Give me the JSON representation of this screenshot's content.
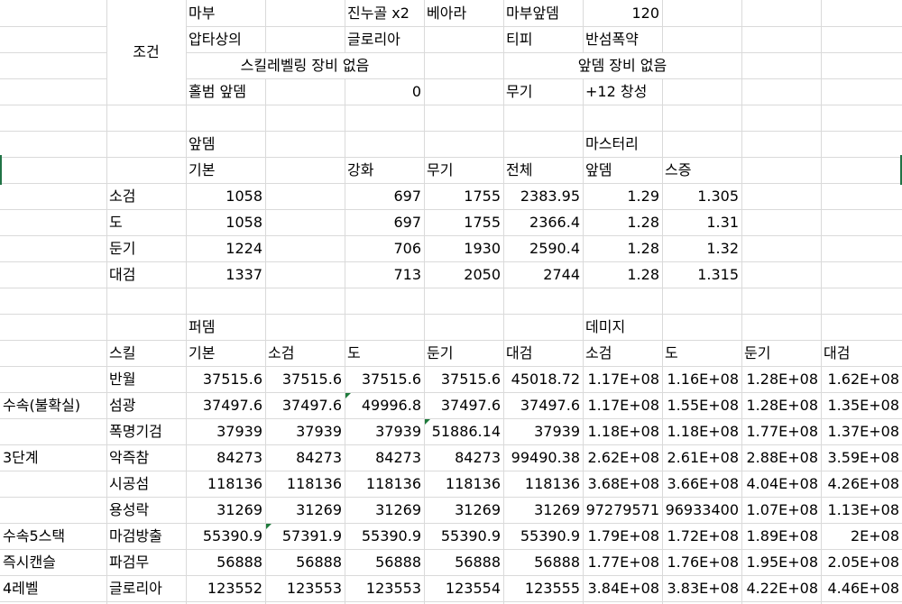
{
  "condition": {
    "title": "조건",
    "mabu": "마부",
    "jinugol": "진누골 x2",
    "beara": "베아라",
    "mabu_apdem": "마부앞뎀",
    "mabu_apdem_value": "120",
    "aptasang": "압타상의",
    "gloria": "글로리아",
    "tipi": "티피",
    "bansum": "반섬폭약",
    "skill_level_note": "스킬레벨링 장비 없음",
    "apdem_equip_note": "앞뎀 장비 없음",
    "holbum": "홀범 앞뎀",
    "holbum_value": "0",
    "weapon": "무기",
    "weapon_value": "+12 창성"
  },
  "apdem": {
    "title": "앞뎀",
    "mastery_title": "마스터리",
    "headers": [
      "기본",
      "강화",
      "무기",
      "전체",
      "앞뎀",
      "스증"
    ],
    "rows": [
      {
        "name": "소검",
        "base": "1058",
        "enh": "697",
        "weapon": "1755",
        "total": "2383.95",
        "mastery": "1.29",
        "skill": "1.305"
      },
      {
        "name": "도",
        "base": "1058",
        "enh": "697",
        "weapon": "1755",
        "total": "2366.4",
        "mastery": "1.28",
        "skill": "1.31"
      },
      {
        "name": "둔기",
        "base": "1224",
        "enh": "706",
        "weapon": "1930",
        "total": "2590.4",
        "mastery": "1.28",
        "skill": "1.32"
      },
      {
        "name": "대검",
        "base": "1337",
        "enh": "713",
        "weapon": "2050",
        "total": "2744",
        "mastery": "1.28",
        "skill": "1.315"
      }
    ]
  },
  "perdem": {
    "title": "퍼뎀",
    "damage_title": "데미지",
    "headers": [
      "스킬",
      "기본",
      "소검",
      "도",
      "둔기",
      "대검",
      "소검",
      "도",
      "둔기",
      "대검"
    ],
    "rows": [
      {
        "group": "",
        "skill": "반월",
        "v": [
          "37515.6",
          "37515.6",
          "37515.6",
          "37515.6",
          "45018.72",
          "1.17E+08",
          "1.16E+08",
          "1.28E+08",
          "1.62E+08"
        ]
      },
      {
        "group": "수속(불확실)",
        "skill": "섬광",
        "v": [
          "37497.6",
          "37497.6",
          "49996.8",
          "37497.6",
          "37497.6",
          "1.17E+08",
          "1.55E+08",
          "1.28E+08",
          "1.35E+08"
        ]
      },
      {
        "group": "",
        "skill": "폭명기검",
        "v": [
          "37939",
          "37939",
          "37939",
          "51886.14",
          "37939",
          "1.18E+08",
          "1.18E+08",
          "1.77E+08",
          "1.37E+08"
        ]
      },
      {
        "group": "3단계",
        "skill": "악즉참",
        "v": [
          "84273",
          "84273",
          "84273",
          "84273",
          "99490.38",
          "2.62E+08",
          "2.61E+08",
          "2.88E+08",
          "3.59E+08"
        ]
      },
      {
        "group": "",
        "skill": "시공섬",
        "v": [
          "118136",
          "118136",
          "118136",
          "118136",
          "118136",
          "3.68E+08",
          "3.66E+08",
          "4.04E+08",
          "4.26E+08"
        ]
      },
      {
        "group": "",
        "skill": "용성락",
        "v": [
          "31269",
          "31269",
          "31269",
          "31269",
          "31269",
          "97279571",
          "96933400",
          "1.07E+08",
          "1.13E+08"
        ]
      },
      {
        "group": "수속5스택",
        "skill": "마검방출",
        "v": [
          "55390.9",
          "57391.9",
          "55390.9",
          "55390.9",
          "55390.9",
          "1.79E+08",
          "1.72E+08",
          "1.89E+08",
          "2E+08"
        ]
      },
      {
        "group": "즉시캔슬",
        "skill": "파검무",
        "v": [
          "56888",
          "56888",
          "56888",
          "56888",
          "56888",
          "1.77E+08",
          "1.76E+08",
          "1.95E+08",
          "2.05E+08"
        ]
      },
      {
        "group": "4레벨",
        "skill": "글로리아",
        "v": [
          "123552",
          "123553",
          "123553",
          "123554",
          "123555",
          "3.84E+08",
          "3.83E+08",
          "4.22E+08",
          "4.46E+08"
        ]
      }
    ]
  }
}
